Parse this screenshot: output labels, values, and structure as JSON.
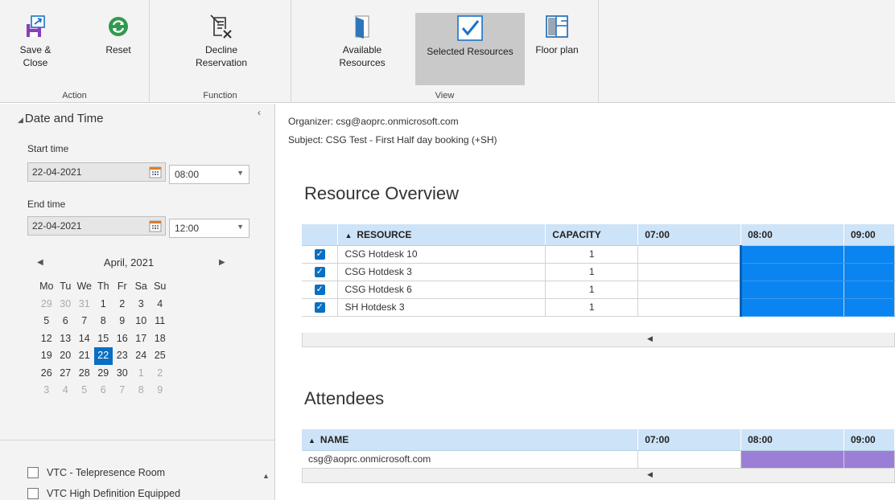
{
  "ribbon": {
    "groups": {
      "action": "Action",
      "function": "Function",
      "view": "View"
    },
    "buttons": {
      "save_close": "Save & Close",
      "reset": "Reset",
      "decline_line1": "Decline",
      "decline_line2": "Reservation",
      "available_line1": "Available",
      "available_line2": "Resources",
      "selected_resources": "Selected Resources",
      "floor_plan": "Floor plan"
    }
  },
  "left_panel": {
    "section_title": "Date and Time",
    "start_label": "Start time",
    "start_date": "22-04-2021",
    "start_time": "08:00",
    "end_label": "End time",
    "end_date": "22-04-2021",
    "end_time": "12:00",
    "calendar": {
      "title": "April, 2021",
      "weekdays": [
        "Mo",
        "Tu",
        "We",
        "Th",
        "Fr",
        "Sa",
        "Su"
      ],
      "weeks": [
        [
          "29",
          "30",
          "31",
          "1",
          "2",
          "3",
          "4"
        ],
        [
          "5",
          "6",
          "7",
          "8",
          "9",
          "10",
          "11"
        ],
        [
          "12",
          "13",
          "14",
          "15",
          "16",
          "17",
          "18"
        ],
        [
          "19",
          "20",
          "21",
          "22",
          "23",
          "24",
          "25"
        ],
        [
          "26",
          "27",
          "28",
          "29",
          "30",
          "1",
          "2"
        ],
        [
          "3",
          "4",
          "5",
          "6",
          "7",
          "8",
          "9"
        ]
      ],
      "selected_day": "22"
    },
    "filters": [
      "VTC - Telepresence Room",
      "VTC High Definition Equipped"
    ]
  },
  "main": {
    "organizer": "Organizer: csg@aoprc.onmicrosoft.com",
    "subject": "Subject: CSG Test - First Half day booking (+SH)",
    "resource_overview": {
      "title": "Resource Overview",
      "columns": {
        "resource": "RESOURCE",
        "capacity": "CAPACITY",
        "t0700": "07:00",
        "t0800": "08:00",
        "t0900": "09:00"
      },
      "rows": [
        {
          "name": "CSG Hotdesk 10",
          "capacity": "1"
        },
        {
          "name": "CSG Hotdesk 3",
          "capacity": "1"
        },
        {
          "name": "CSG Hotdesk 6",
          "capacity": "1"
        },
        {
          "name": "SH Hotdesk 3",
          "capacity": "1"
        }
      ]
    },
    "attendees": {
      "title": "Attendees",
      "columns": {
        "name": "NAME",
        "t0700": "07:00",
        "t0800": "08:00",
        "t0900": "09:00"
      },
      "rows": [
        {
          "name": "csg@aoprc.onmicrosoft.com"
        }
      ]
    }
  },
  "colors": {
    "selection_blue": "#0a6fc2",
    "booking_blue": "#0a84f0",
    "attendee_purple": "#9b7fd6",
    "header_blue": "#cde3f7"
  }
}
